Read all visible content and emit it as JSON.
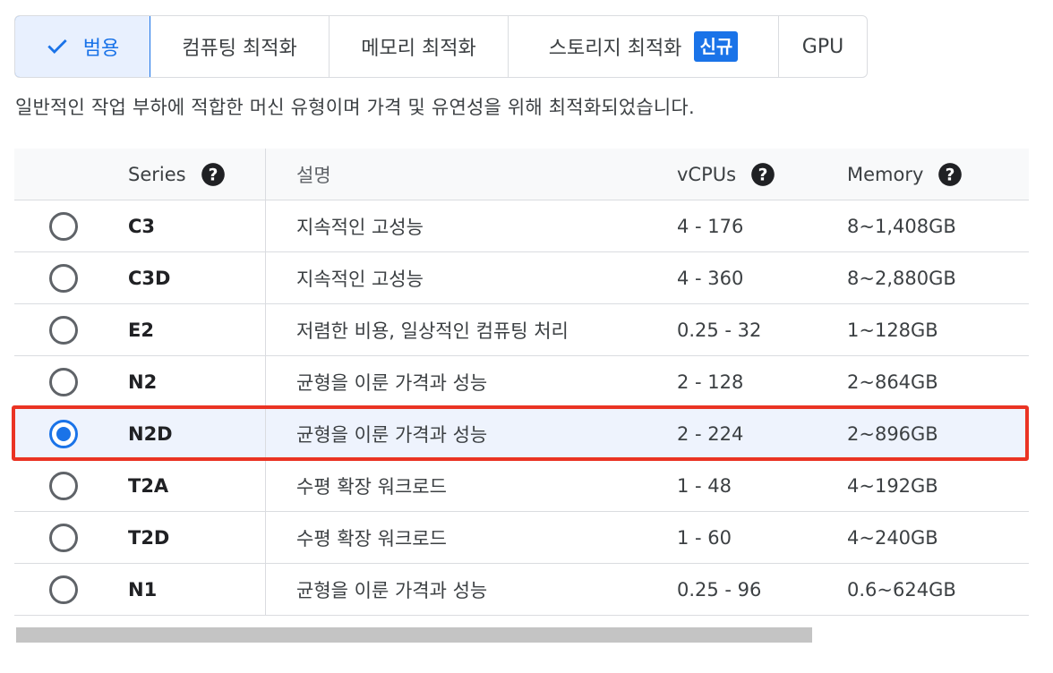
{
  "tabs": [
    {
      "label": "범용",
      "selected": true
    },
    {
      "label": "컴퓨팅 최적화",
      "selected": false
    },
    {
      "label": "메모리 최적화",
      "selected": false
    },
    {
      "label": "스토리지 최적화",
      "badge": "신규",
      "selected": false
    },
    {
      "label": "GPU",
      "selected": false
    }
  ],
  "description": "일반적인 작업 부하에 적합한 머신 유형이며 가격 및 유연성을 위해 최적화되었습니다.",
  "table": {
    "headers": {
      "series": "Series",
      "description": "설명",
      "vcpus": "vCPUs",
      "memory": "Memory"
    },
    "rows": [
      {
        "series": "C3",
        "description": "지속적인 고성능",
        "vcpus": "4 - 176",
        "memory": "8~1,408GB",
        "selected": false
      },
      {
        "series": "C3D",
        "description": "지속적인 고성능",
        "vcpus": "4 - 360",
        "memory": "8~2,880GB",
        "selected": false
      },
      {
        "series": "E2",
        "description": "저렴한 비용, 일상적인 컴퓨팅 처리",
        "vcpus": "0.25 - 32",
        "memory": "1~128GB",
        "selected": false
      },
      {
        "series": "N2",
        "description": "균형을 이룬 가격과 성능",
        "vcpus": "2 - 128",
        "memory": "2~864GB",
        "selected": false
      },
      {
        "series": "N2D",
        "description": "균형을 이룬 가격과 성능",
        "vcpus": "2 - 224",
        "memory": "2~896GB",
        "selected": true
      },
      {
        "series": "T2A",
        "description": "수평 확장 워크로드",
        "vcpus": "1 - 48",
        "memory": "4~192GB",
        "selected": false
      },
      {
        "series": "T2D",
        "description": "수평 확장 워크로드",
        "vcpus": "1 - 60",
        "memory": "4~240GB",
        "selected": false
      },
      {
        "series": "N1",
        "description": "균형을 이룬 가격과 성능",
        "vcpus": "0.25 - 96",
        "memory": "0.6~624GB",
        "selected": false
      }
    ]
  },
  "icons": {
    "check": "check-icon",
    "help": "help-circle-icon"
  },
  "colors": {
    "accent": "#1a73e8",
    "highlight": "#ea3323",
    "selected_row_bg": "#eef3fd"
  }
}
